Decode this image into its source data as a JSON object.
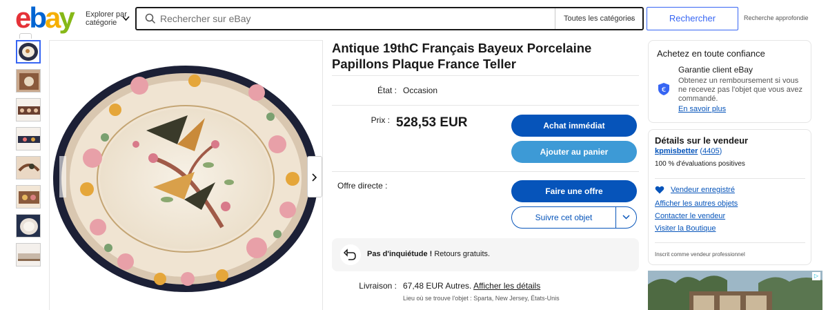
{
  "header": {
    "logo_letters": [
      "e",
      "b",
      "a",
      "y"
    ],
    "explore_label": "Explorer par catégorie",
    "search_placeholder": "Rechercher sur eBay",
    "category_select": "Toutes les catégories",
    "search_button": "Rechercher",
    "advanced_search": "Recherche approfondie"
  },
  "gallery": {
    "thumbnail_count": 8,
    "active_index": 0
  },
  "listing": {
    "title": "Antique 19thC Français Bayeux Porcelaine Papillons Plaque France Teller",
    "etat_label": "État :",
    "etat_value": "Occasion",
    "prix_label": "Prix :",
    "price": "528,53 EUR",
    "buy_now": "Achat immédiat",
    "add_to_cart": "Ajouter au panier",
    "offer_label": "Offre directe :",
    "make_offer": "Faire une offre",
    "watch": "Suivre cet objet",
    "returns_bold": "Pas d'inquiétude !",
    "returns_text": " Retours gratuits.",
    "livraison_label": "Livraison :",
    "livraison_cost": "67,48 EUR Autres.",
    "livraison_link": "Afficher les détails",
    "location": "Lieu où se trouve l'objet : Sparta, New Jersey, États-Unis"
  },
  "confidence": {
    "title": "Achetez en toute confiance",
    "guarantee_title": "Garantie client eBay",
    "guarantee_text": "Obtenez un remboursement si vous ne recevez pas l'objet que vous avez commandé.",
    "learn_more": "En savoir plus"
  },
  "seller": {
    "title": "Détails sur le vendeur",
    "name": "kpmisbetter",
    "feedback": "4405",
    "positive": "100 % d'évaluations positives",
    "saved": "Vendeur enregistré",
    "other_items": "Afficher les autres objets",
    "contact": "Contacter le vendeur",
    "store": "Visiter la Boutique",
    "professional": "Inscrit comme vendeur professionnel"
  },
  "colors": {
    "accent": "#0654ba",
    "accent_light": "#3d9ad6",
    "search_blue": "#3665f3",
    "logo_red": "#e53238",
    "logo_blue": "#0064d2",
    "logo_yellow": "#f5af02",
    "logo_green": "#86b817"
  }
}
